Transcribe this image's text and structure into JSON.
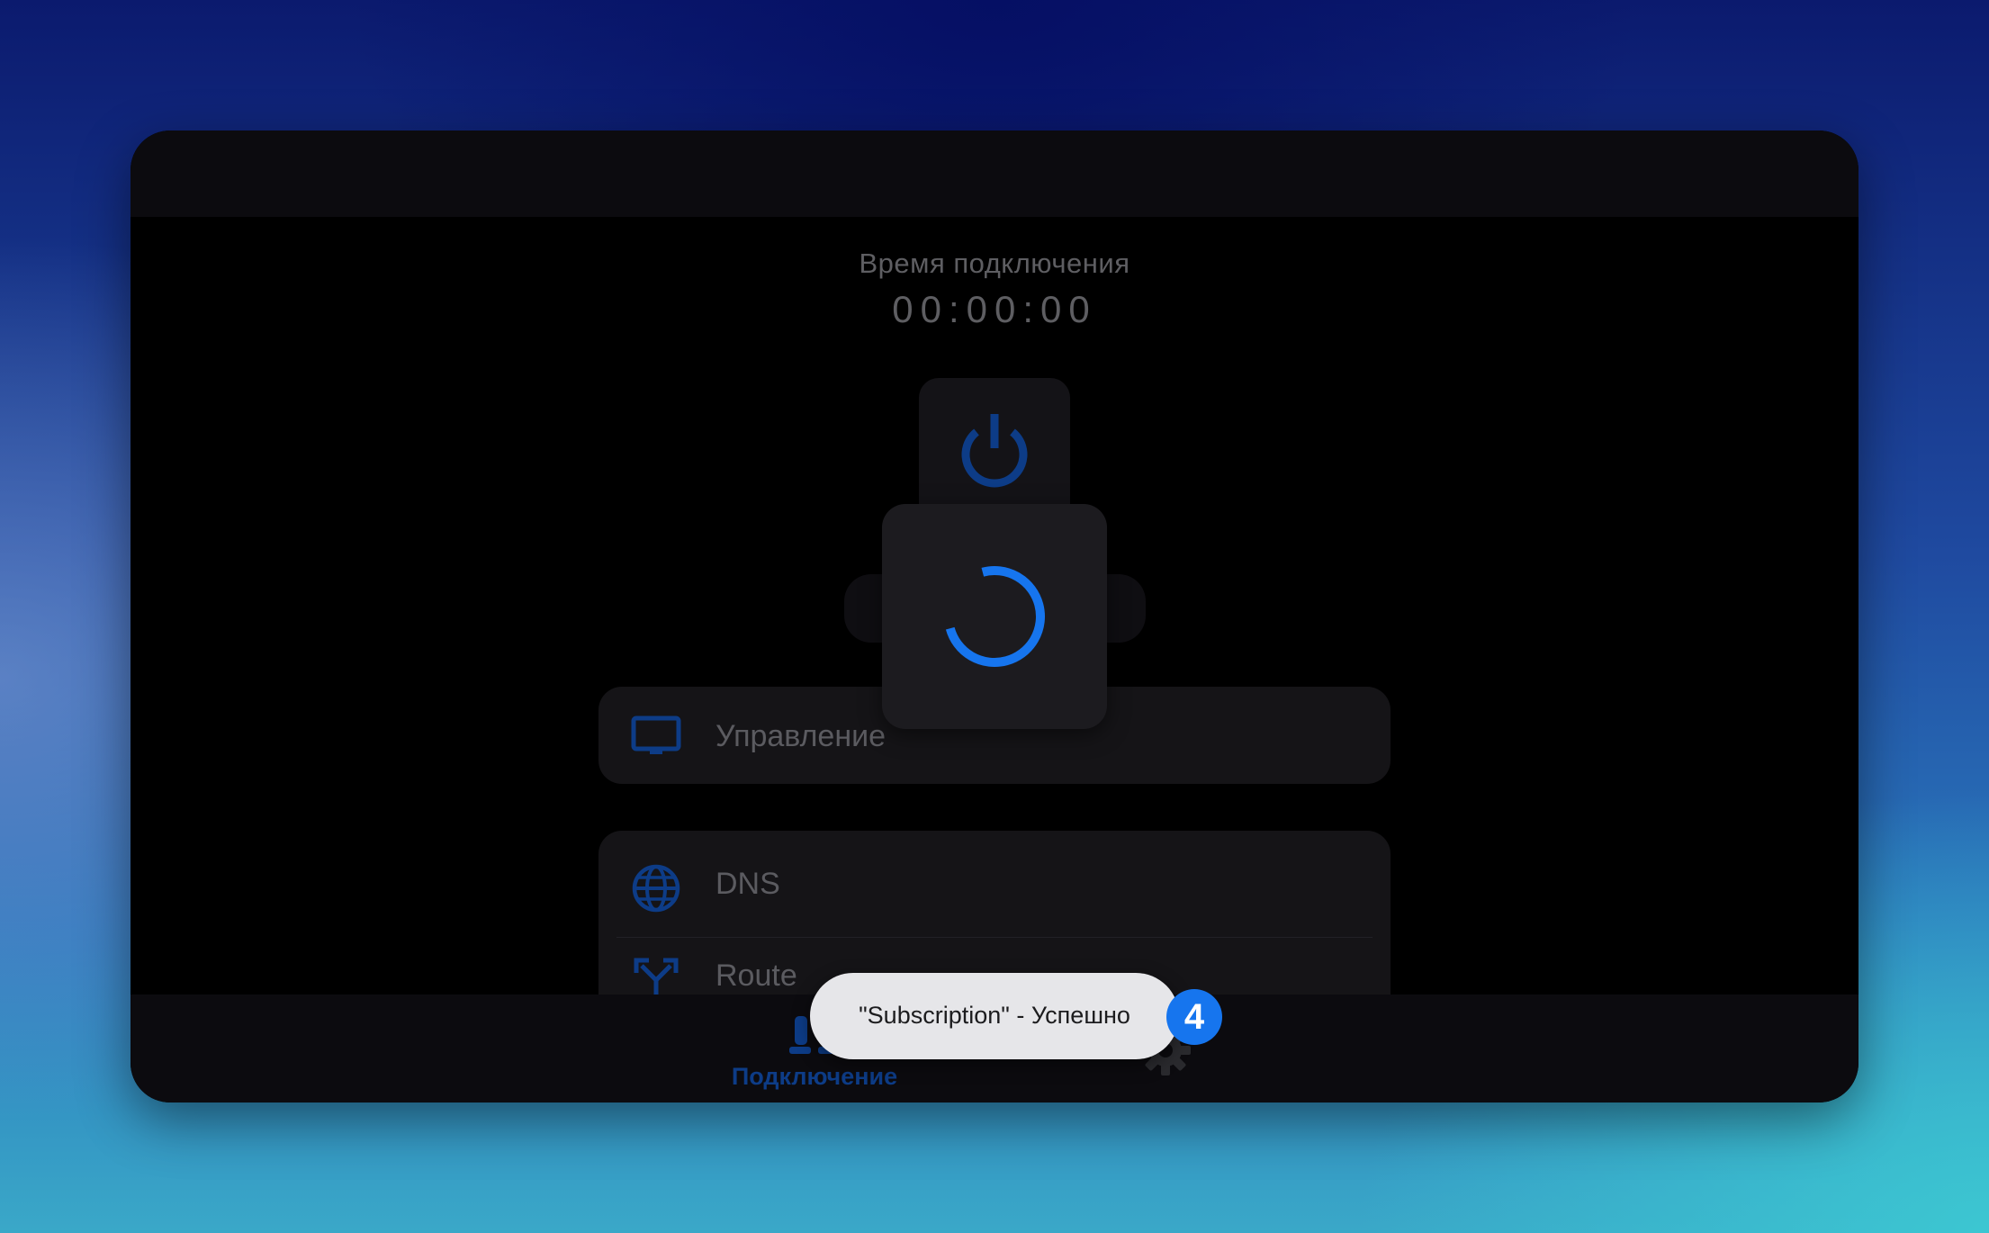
{
  "status": {
    "timer_label": "Время подключения",
    "timer_value": "00:00:00"
  },
  "menu": {
    "manage_label": "Управление",
    "dns_label": "DNS",
    "route_label": "Route"
  },
  "nav": {
    "connect_label": "Подключение"
  },
  "toast": {
    "message": "\"Subscription\" - Успешно",
    "badge": "4"
  },
  "colors": {
    "accent": "#1675ee",
    "icon_dim": "#0d3c87",
    "text_dim": "#5e5e62",
    "window_bg": "#000000",
    "card_bg": "#151417",
    "toast_bg": "#e6e6e9"
  },
  "icons": {
    "power": "power-icon",
    "monitor": "monitor-icon",
    "dns": "globe-icon",
    "route": "route-split-icon",
    "connect": "plug-icon",
    "settings": "gear-icon",
    "loading": "spinner-icon"
  }
}
